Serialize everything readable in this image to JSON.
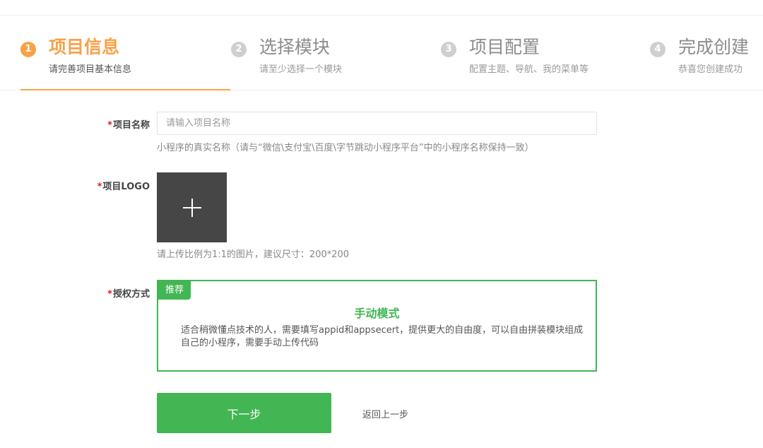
{
  "steps": [
    {
      "num": "1",
      "title": "项目信息",
      "sub": "请完善项目基本信息"
    },
    {
      "num": "2",
      "title": "选择模块",
      "sub": "请至少选择一个模块"
    },
    {
      "num": "3",
      "title": "项目配置",
      "sub": "配置主题、导航、我的菜单等"
    },
    {
      "num": "4",
      "title": "完成创建",
      "sub": "恭喜您创建成功"
    }
  ],
  "form": {
    "required_mark": "*",
    "name_label": "项目名称",
    "name_placeholder": "请输入项目名称",
    "name_value": "",
    "name_hint": "小程序的真实名称（请与“微信\\支付宝\\百度\\字节跳动小程序平台”中的小程序名称保持一致）",
    "logo_label": "项目LOGO",
    "logo_hint": "请上传比例为1:1的图片，建议尺寸：200*200",
    "auth_label": "授权方式",
    "auth_badge": "推荐",
    "auth_title": "手动模式",
    "auth_desc": "适合稍微懂点技术的人，需要填写appid和appsecert，提供更大的自由度，可以自由拼装模块组成自己的小程序，需要手动上传代码"
  },
  "actions": {
    "next_label": "下一步",
    "back_label": "返回上一步"
  },
  "colors": {
    "accent_orange": "#f7a24a",
    "accent_green": "#42b653",
    "required_red": "#e02020"
  }
}
